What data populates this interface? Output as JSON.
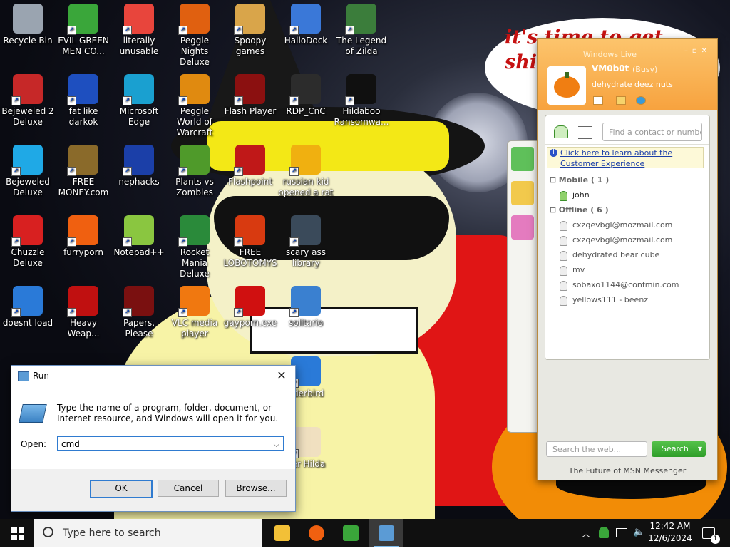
{
  "desktop": {
    "wallpaper_text": "it's time to get shit and or t",
    "icons": [
      {
        "label": "Recycle Bin",
        "icon": "recycle-bin-icon",
        "color": "#9aa4b0"
      },
      {
        "label": "EVIL GREEN MEN CO...",
        "icon": "msn-buddies-icon",
        "color": "#3aa63a"
      },
      {
        "label": "literally unusable",
        "icon": "chrome-icon",
        "color": "#e8453c"
      },
      {
        "label": "Peggle Nights Deluxe",
        "icon": "peggle-icon",
        "color": "#e06010"
      },
      {
        "label": "Spoopy games",
        "icon": "folder-games-icon",
        "color": "#d9a54a"
      },
      {
        "label": "HalloDock",
        "icon": "windows-shield-icon",
        "color": "#3a78d8"
      },
      {
        "label": "The Legend of Zilda",
        "icon": "zelda-icon",
        "color": "#3b7d3b"
      },
      {
        "label": "Bejeweled 2 Deluxe",
        "icon": "bejeweled2-icon",
        "color": "#c62828"
      },
      {
        "label": "fat like darkok",
        "icon": "mpl-icon",
        "color": "#1e4fbf"
      },
      {
        "label": "Microsoft Edge",
        "icon": "edge-icon",
        "color": "#1aa0d0"
      },
      {
        "label": "Peggle World of Warcraft",
        "icon": "peggle-wow-icon",
        "color": "#e08a10"
      },
      {
        "label": "Flash Player",
        "icon": "flash-icon",
        "color": "#8b1010"
      },
      {
        "label": "RDP_CnC",
        "icon": "rdp-icon",
        "color": "#2c2c2c"
      },
      {
        "label": "Hildaboo Ransomwa...",
        "icon": "yashma-icon",
        "color": "#101010"
      },
      {
        "label": "Bejeweled Deluxe",
        "icon": "gem-icon",
        "color": "#1fa9e6"
      },
      {
        "label": "FREE MONEY.com",
        "icon": "money-bag-icon",
        "color": "#8a6a2a"
      },
      {
        "label": "nephacks",
        "icon": "mpi-icon",
        "color": "#1b3fa8"
      },
      {
        "label": "Plants vs Zombies",
        "icon": "pvz-icon",
        "color": "#4f9a2a"
      },
      {
        "label": "Flashpoint",
        "icon": "flashpoint-icon",
        "color": "#c01818"
      },
      {
        "label": "russian kid opened a rat",
        "icon": "de-icon",
        "color": "#f0b010"
      },
      {
        "label": "Chuzzle Deluxe",
        "icon": "chuzzle-icon",
        "color": "#d82020"
      },
      {
        "label": "furryporn",
        "icon": "firefox-icon",
        "color": "#f06010"
      },
      {
        "label": "Notepad++",
        "icon": "notepad-plus-plus-icon",
        "color": "#8ac640"
      },
      {
        "label": "Rocket Mania Deluxe",
        "icon": "rocket-icon",
        "color": "#2a8a3a"
      },
      {
        "label": "FREE LOBOTOMYS",
        "icon": "stopwatch-icon",
        "color": "#d83a10"
      },
      {
        "label": "scary ass library",
        "icon": "library-icon",
        "color": "#3a4a5a"
      },
      {
        "label": "doesnt load",
        "icon": "thunderbird-icon",
        "color": "#2a7ad8"
      },
      {
        "label": "Heavy Weap...",
        "icon": "radiation-icon",
        "color": "#c01010"
      },
      {
        "label": "Papers, Please",
        "icon": "papers-please-icon",
        "color": "#7a1010"
      },
      {
        "label": "VLC media player",
        "icon": "vlc-icon",
        "color": "#f07810"
      },
      {
        "label": "gayporn.exe",
        "icon": "flash-red-icon",
        "color": "#d01010"
      },
      {
        "label": "solitario",
        "icon": "solitaire-icon",
        "color": "#3a80d0"
      },
      {
        "label": "nderbird",
        "icon": "thunderbird2-icon",
        "color": "#2a7ad8"
      },
      {
        "label": "ber Hilda",
        "icon": "pixel-hilda-icon",
        "color": "#f0e0c0"
      }
    ]
  },
  "run_dialog": {
    "title": "Run",
    "description": "Type the name of a program, folder, document, or Internet resource, and Windows will open it for you.",
    "open_label": "Open:",
    "open_value": "cmd",
    "ok_label": "OK",
    "cancel_label": "Cancel",
    "browse_label": "Browse..."
  },
  "msn": {
    "title": "Windows Live",
    "display_name": "VM0b0t",
    "status": "(Busy)",
    "personal_message": "dehydrate deez nuts",
    "find_placeholder": "Find a contact or numbe",
    "ad_text": "Click here to learn about the Customer Experience",
    "groups": [
      {
        "label": "Mobile ( 1 )",
        "contacts": [
          "john"
        ],
        "online": true
      },
      {
        "label": "Offline ( 6 )",
        "contacts": [
          "cxzqevbgl@mozmail.com",
          "cxzqevbgl@mozmail.com",
          "dehydrated bear cube",
          "mv",
          "sobaxo1144@confmin.com",
          "yellows111 - beenz"
        ],
        "online": false
      }
    ],
    "search_placeholder": "Search the web...",
    "search_button": "Search",
    "footer": "The Future of MSN Messenger",
    "accent": "#f7a23e"
  },
  "taskbar": {
    "search_placeholder": "Type here to search",
    "pinned": [
      {
        "name": "file-explorer-icon",
        "color": "#f2c037"
      },
      {
        "name": "firefox-icon",
        "color": "#f06010"
      },
      {
        "name": "msn-messenger-icon",
        "color": "#3aa63a"
      },
      {
        "name": "run-dialog-icon",
        "color": "#5b9bd5"
      }
    ],
    "time": "12:42 AM",
    "date": "12/6/2024",
    "notification_count": "1"
  }
}
